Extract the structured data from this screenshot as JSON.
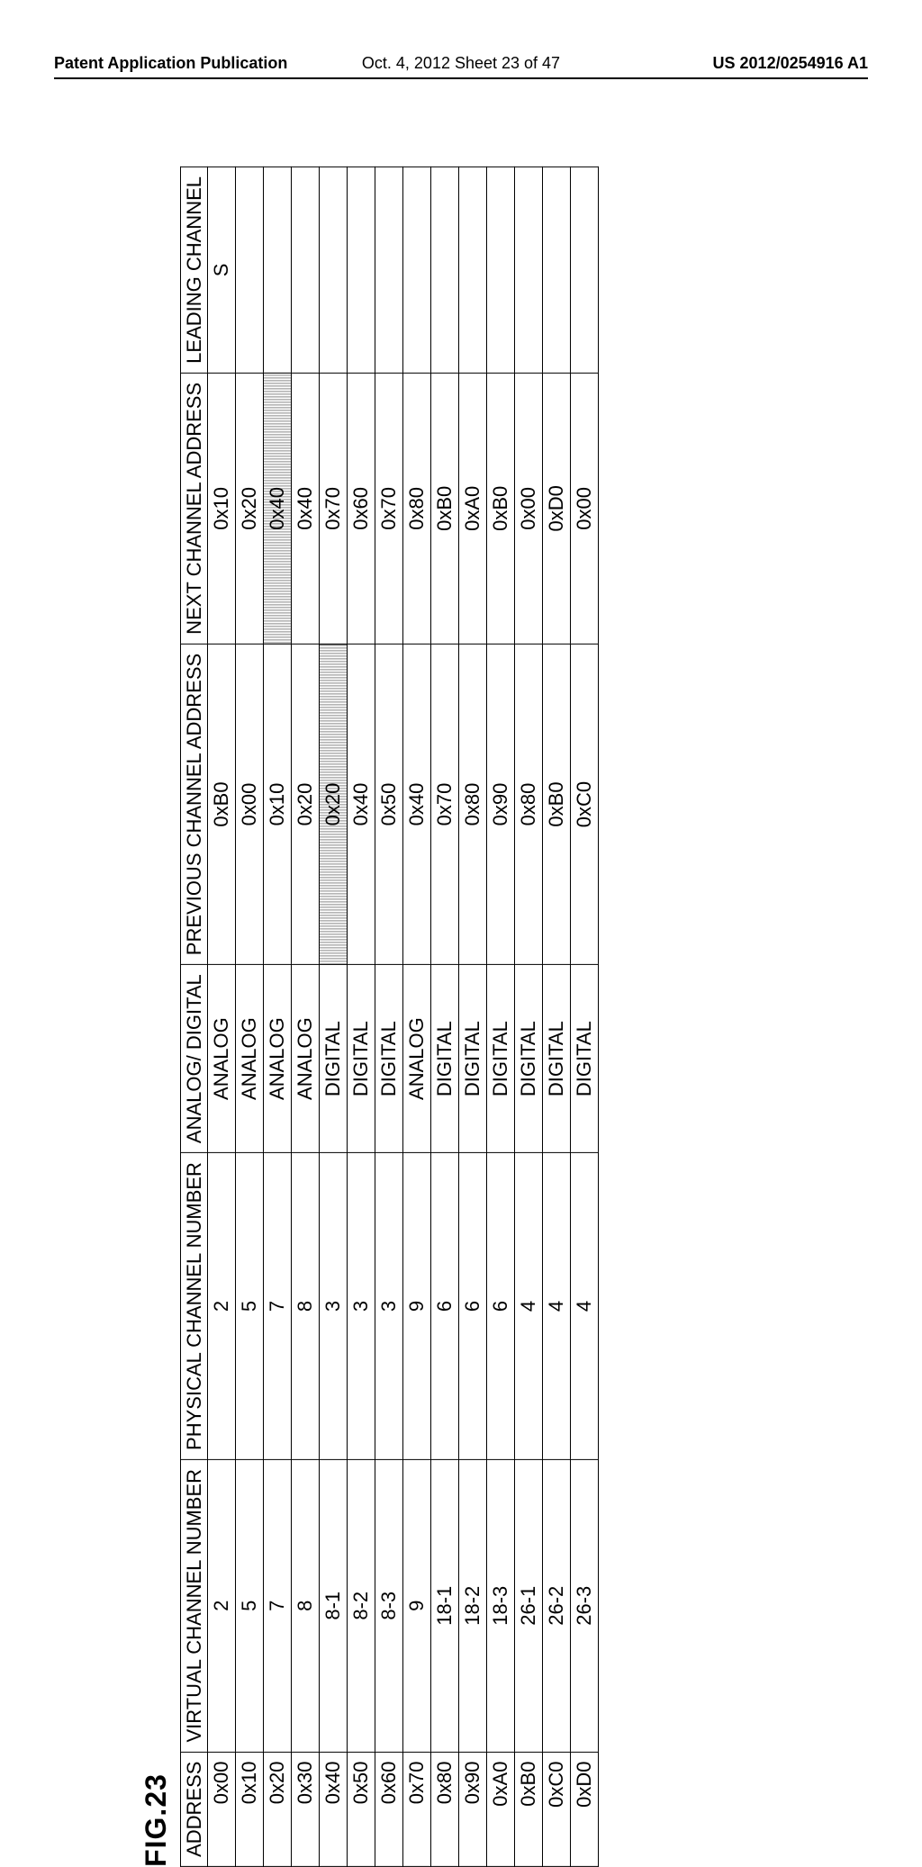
{
  "header": {
    "left": "Patent Application Publication",
    "center": "Oct. 4, 2012  Sheet 23 of 47",
    "right": "US 2012/0254916 A1"
  },
  "figure_label": "FIG.23",
  "columns": {
    "c0": "ADDRESS",
    "c1": "VIRTUAL\nCHANNEL\nNUMBER",
    "c2": "PHYSICAL\nCHANNEL\nNUMBER",
    "c3": "ANALOG/\nDIGITAL",
    "c4": "PREVIOUS\nCHANNEL\nADDRESS",
    "c5": "NEXT\nCHANNEL\nADDRESS",
    "c6": "LEADING\nCHANNEL"
  },
  "rows": [
    {
      "addr": "0x00",
      "vcn": "2",
      "pcn": "2",
      "ad": "ANALOG",
      "prev": "0xB0",
      "next": "0x10",
      "lead": "S",
      "prev_sh": false,
      "next_sh": false
    },
    {
      "addr": "0x10",
      "vcn": "5",
      "pcn": "5",
      "ad": "ANALOG",
      "prev": "0x00",
      "next": "0x20",
      "lead": "",
      "prev_sh": false,
      "next_sh": false
    },
    {
      "addr": "0x20",
      "vcn": "7",
      "pcn": "7",
      "ad": "ANALOG",
      "prev": "0x10",
      "next": "0x40",
      "lead": "",
      "prev_sh": false,
      "next_sh": true
    },
    {
      "addr": "0x30",
      "vcn": "8",
      "pcn": "8",
      "ad": "ANALOG",
      "prev": "0x20",
      "next": "0x40",
      "lead": "",
      "prev_sh": false,
      "next_sh": false
    },
    {
      "addr": "0x40",
      "vcn": "8-1",
      "pcn": "3",
      "ad": "DIGITAL",
      "prev": "0x20",
      "next": "0x70",
      "lead": "",
      "prev_sh": true,
      "next_sh": false
    },
    {
      "addr": "0x50",
      "vcn": "8-2",
      "pcn": "3",
      "ad": "DIGITAL",
      "prev": "0x40",
      "next": "0x60",
      "lead": "",
      "prev_sh": false,
      "next_sh": false
    },
    {
      "addr": "0x60",
      "vcn": "8-3",
      "pcn": "3",
      "ad": "DIGITAL",
      "prev": "0x50",
      "next": "0x70",
      "lead": "",
      "prev_sh": false,
      "next_sh": false
    },
    {
      "addr": "0x70",
      "vcn": "9",
      "pcn": "9",
      "ad": "ANALOG",
      "prev": "0x40",
      "next": "0x80",
      "lead": "",
      "prev_sh": false,
      "next_sh": false
    },
    {
      "addr": "0x80",
      "vcn": "18-1",
      "pcn": "6",
      "ad": "DIGITAL",
      "prev": "0x70",
      "next": "0xB0",
      "lead": "",
      "prev_sh": false,
      "next_sh": false
    },
    {
      "addr": "0x90",
      "vcn": "18-2",
      "pcn": "6",
      "ad": "DIGITAL",
      "prev": "0x80",
      "next": "0xA0",
      "lead": "",
      "prev_sh": false,
      "next_sh": false
    },
    {
      "addr": "0xA0",
      "vcn": "18-3",
      "pcn": "6",
      "ad": "DIGITAL",
      "prev": "0x90",
      "next": "0xB0",
      "lead": "",
      "prev_sh": false,
      "next_sh": false
    },
    {
      "addr": "0xB0",
      "vcn": "26-1",
      "pcn": "4",
      "ad": "DIGITAL",
      "prev": "0x80",
      "next": "0x00",
      "lead": "",
      "prev_sh": false,
      "next_sh": false
    },
    {
      "addr": "0xC0",
      "vcn": "26-2",
      "pcn": "4",
      "ad": "DIGITAL",
      "prev": "0xB0",
      "next": "0xD0",
      "lead": "",
      "prev_sh": false,
      "next_sh": false
    },
    {
      "addr": "0xD0",
      "vcn": "26-3",
      "pcn": "4",
      "ad": "DIGITAL",
      "prev": "0xC0",
      "next": "0x00",
      "lead": "",
      "prev_sh": false,
      "next_sh": false
    }
  ]
}
